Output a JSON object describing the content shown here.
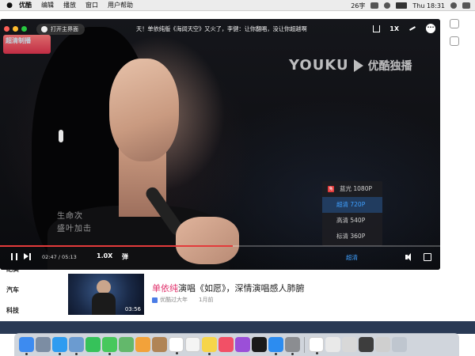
{
  "menubar": {
    "app_name": "优酷",
    "items": [
      "编辑",
      "播放",
      "窗口",
      "用户帮助"
    ],
    "input_method": "26字",
    "clock": "Thu 18:31"
  },
  "player": {
    "open_main_label": "打开主界面",
    "video_title": "天！单依纯版《海阔天空》又火了，李健：让你翻唱，没让你超越啊",
    "speed_top": "1X",
    "logo_text": "超清制播",
    "watermark_brand": "YOUKU",
    "watermark_cn": "优酷独播",
    "subtitle_lines": [
      "生命次",
      "盛叶加击"
    ],
    "quality_options": [
      {
        "label": "蓝光 1080P",
        "badge": "兔",
        "active": false
      },
      {
        "label": "超清 720P",
        "active": true
      },
      {
        "label": "高清 540P",
        "active": false
      },
      {
        "label": "标清 360P",
        "active": false
      }
    ],
    "progress": 0.528,
    "time_display": "02:47 / 05:13",
    "speed_bottom": "1.0X",
    "danmu_label": "弹",
    "quality_label": "超清"
  },
  "page": {
    "categories": [
      "纪实",
      "汽车",
      "科技"
    ],
    "rec_item": {
      "title_highlight": "单依纯",
      "title_rest": "演唱《如愿》，深情演唱感人肺腑",
      "duration": "03:56",
      "uploader": "优酷过大年",
      "time_ago": "1月前"
    }
  },
  "dock": {
    "apps": [
      {
        "name": "finder-icon",
        "color": "#3d8bf0"
      },
      {
        "name": "launchpad-icon",
        "color": "#7c8da3"
      },
      {
        "name": "safari-icon",
        "color": "#2e9cf0"
      },
      {
        "name": "preview-icon",
        "color": "#6b9bd0"
      },
      {
        "name": "facetime-icon",
        "color": "#36c25a"
      },
      {
        "name": "messages-icon",
        "color": "#47c85c"
      },
      {
        "name": "maps-icon",
        "color": "#63b86b"
      },
      {
        "name": "photos-icon",
        "color": "#f2a23a"
      },
      {
        "name": "contacts-icon",
        "color": "#b08455"
      },
      {
        "name": "calendar-icon",
        "color": "#ffffff"
      },
      {
        "name": "reminders-icon",
        "color": "#f4f4f4"
      },
      {
        "name": "notes-icon",
        "color": "#f6d54a"
      },
      {
        "name": "music-icon",
        "color": "#f25066"
      },
      {
        "name": "podcasts-icon",
        "color": "#9b4fd8"
      },
      {
        "name": "tv-icon",
        "color": "#1a1a1a"
      },
      {
        "name": "appstore-icon",
        "color": "#2c8cf0"
      },
      {
        "name": "settings-icon",
        "color": "#8b8d91"
      },
      {
        "name": "youku-icon",
        "color": "#ffffff"
      },
      {
        "name": "file-icon",
        "color": "#e9e9e9"
      },
      {
        "name": "screenshot-icon",
        "color": "#d8d8d8"
      },
      {
        "name": "window-icon",
        "color": "#3d3d3d"
      },
      {
        "name": "window2-icon",
        "color": "#cfcfcf"
      },
      {
        "name": "trash-icon",
        "color": "#bfc6cf"
      }
    ]
  }
}
